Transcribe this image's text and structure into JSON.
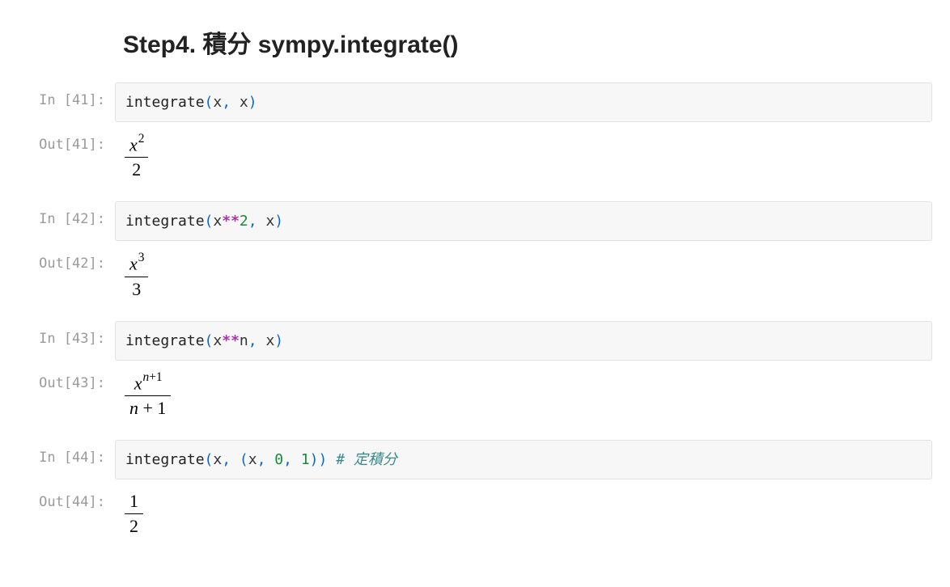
{
  "heading": "Step4. 積分 sympy.integrate()",
  "cells": [
    {
      "in_label": "In [41]:",
      "out_label": "Out[41]:",
      "code": {
        "fn": "integrate",
        "p1": "(",
        "arg1": "x",
        "c1": ",",
        "sp1": " ",
        "arg2": "x",
        "p2": ")"
      },
      "math": {
        "num_base": "x",
        "num_sup": "2",
        "den": "2"
      }
    },
    {
      "in_label": "In [42]:",
      "out_label": "Out[42]:",
      "code": {
        "fn": "integrate",
        "p1": "(",
        "arg1": "x",
        "op": "**",
        "exp": "2",
        "c1": ",",
        "sp1": " ",
        "arg2": "x",
        "p2": ")"
      },
      "math": {
        "num_base": "x",
        "num_sup": "3",
        "den": "3"
      }
    },
    {
      "in_label": "In [43]:",
      "out_label": "Out[43]:",
      "code": {
        "fn": "integrate",
        "p1": "(",
        "arg1": "x",
        "op": "**",
        "expv": "n",
        "c1": ",",
        "sp1": " ",
        "arg2": "x",
        "p2": ")"
      },
      "math": {
        "num_base": "x",
        "num_sup_var": "n",
        "num_sup_plus": "+1",
        "den_var": "n",
        "den_rest": " + 1"
      }
    },
    {
      "in_label": "In [44]:",
      "out_label": "Out[44]:",
      "code": {
        "fn": "integrate",
        "p1": "(",
        "arg1": "x",
        "c1": ",",
        "sp1": " ",
        "tp1": "(",
        "targ1": "x",
        "tc1": ",",
        "tsp1": " ",
        "t0": "0",
        "tc2": ",",
        "tsp2": " ",
        "t1": "1",
        "tp2": ")",
        "p2": ")",
        "csp": "  ",
        "comment": "# 定積分"
      },
      "math": {
        "num_plain": "1",
        "den": "2"
      }
    }
  ]
}
